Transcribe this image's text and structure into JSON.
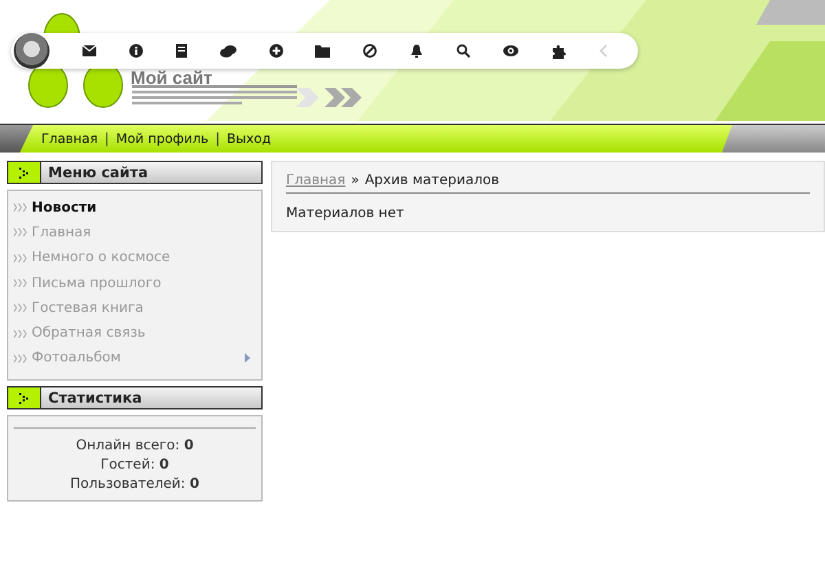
{
  "header": {
    "site_title": "Мой сайт"
  },
  "toolbar": {
    "icons": [
      {
        "kind": "avatar"
      },
      {
        "kind": "mail"
      },
      {
        "kind": "info"
      },
      {
        "kind": "document"
      },
      {
        "kind": "chat"
      },
      {
        "kind": "plus"
      },
      {
        "kind": "folder"
      },
      {
        "kind": "forbidden"
      },
      {
        "kind": "bell"
      },
      {
        "kind": "search"
      },
      {
        "kind": "eye"
      },
      {
        "kind": "puzzle"
      },
      {
        "kind": "back",
        "disabled": true
      }
    ]
  },
  "top_nav": {
    "separator": "|",
    "links": [
      "Главная",
      "Мой профиль",
      "Выход"
    ]
  },
  "site_menu": {
    "title": "Меню сайта",
    "items": [
      {
        "label": "Новости",
        "selected": true,
        "has_submenu": false
      },
      {
        "label": "Главная",
        "selected": false,
        "has_submenu": false
      },
      {
        "label": "Немного о космосе",
        "selected": false,
        "has_submenu": false
      },
      {
        "label": "Письма прошлого",
        "selected": false,
        "has_submenu": false
      },
      {
        "label": "Гостевая книга",
        "selected": false,
        "has_submenu": false
      },
      {
        "label": "Обратная связь",
        "selected": false,
        "has_submenu": false
      },
      {
        "label": "Фотоальбом",
        "selected": false,
        "has_submenu": true
      }
    ]
  },
  "statistics": {
    "title": "Статистика",
    "rows": [
      {
        "label": "Онлайн всего:",
        "value": "0"
      },
      {
        "label": "Гостей:",
        "value": "0"
      },
      {
        "label": "Пользователей:",
        "value": "0"
      }
    ]
  },
  "breadcrumb": {
    "link": "Главная",
    "separator": "»",
    "current": "Архив материалов"
  },
  "content": {
    "message": "Материалов нет"
  }
}
